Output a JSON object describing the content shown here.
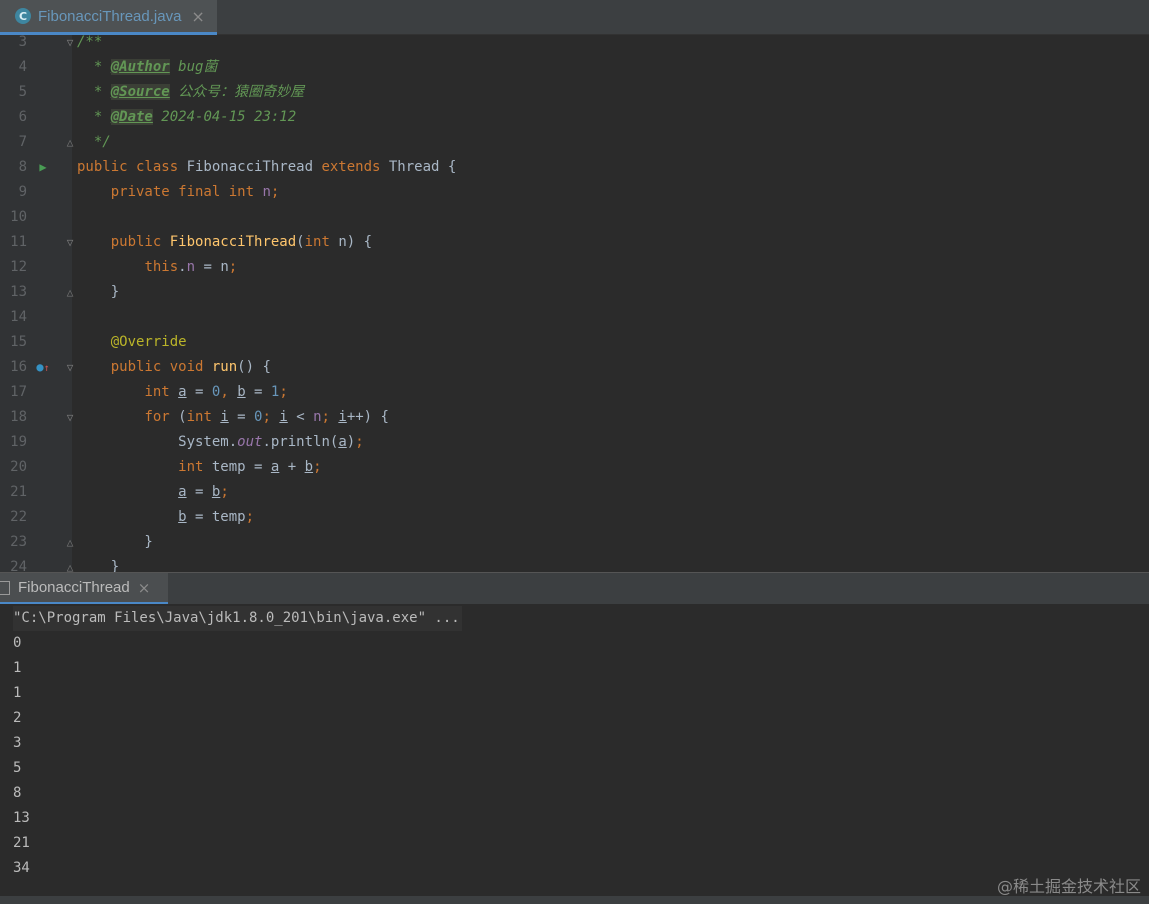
{
  "editor_tab": {
    "icon": "C",
    "label": "FibonacciThread.java",
    "close": "×"
  },
  "code_lines": [
    {
      "n": "3",
      "fold": "▽",
      "html": "<span class=\"cm\">/**</span>"
    },
    {
      "n": "4",
      "html": "<span class=\"cm\">  * </span><span class=\"tag\">@Author</span><span class=\"cm\"> bug菌</span>"
    },
    {
      "n": "5",
      "html": "<span class=\"cm\">  * </span><span class=\"tag\">@Source</span><span class=\"cm\"> 公众号：猿圈奇妙屋</span>"
    },
    {
      "n": "6",
      "html": "<span class=\"cm\">  * </span><span class=\"tag\">@Date</span><span class=\"cm\"> 2024-04-15 23:12</span>"
    },
    {
      "n": "7",
      "fold": "△",
      "html": "<span class=\"cm\">  */</span>"
    },
    {
      "n": "8",
      "icon": "run",
      "html": "<span class=\"kw\">public class </span>FibonacciThread <span class=\"kw\">extends </span>Thread {"
    },
    {
      "n": "9",
      "html": "    <span class=\"kw\">private final int </span><span class=\"fld\">n</span><span class=\"kw\">;</span>"
    },
    {
      "n": "10",
      "html": ""
    },
    {
      "n": "11",
      "fold": "▽",
      "html": "    <span class=\"kw\">public </span><span class=\"fn\">FibonacciThread</span>(<span class=\"kw\">int </span>n) {"
    },
    {
      "n": "12",
      "html": "        <span class=\"kw\">this</span>.<span class=\"fld\">n</span> = n<span class=\"kw\">;</span>"
    },
    {
      "n": "13",
      "fold": "△",
      "html": "    }"
    },
    {
      "n": "14",
      "html": ""
    },
    {
      "n": "15",
      "html": "    <span class=\"ann\">@Override</span>"
    },
    {
      "n": "16",
      "icon": "override",
      "fold": "▽",
      "html": "    <span class=\"kw\">public void </span><span class=\"fn\">run</span>() {"
    },
    {
      "n": "17",
      "html": "        <span class=\"kw\">int </span><span class=\"ul\">a</span> = <span class=\"num\">0</span><span class=\"kw\">, </span><span class=\"ul\">b</span> = <span class=\"num\">1</span><span class=\"kw\">;</span>"
    },
    {
      "n": "18",
      "fold": "▽",
      "html": "        <span class=\"kw\">for </span>(<span class=\"kw\">int </span><span class=\"ul\">i</span> = <span class=\"num\">0</span><span class=\"kw\">; </span><span class=\"ul\">i</span> &lt; <span class=\"fld\">n</span><span class=\"kw\">; </span><span class=\"ul\">i</span>++) {"
    },
    {
      "n": "19",
      "html": "            System.<span class=\"fld-i\">out</span>.println(<span class=\"ul\">a</span>)<span class=\"kw\">;</span>"
    },
    {
      "n": "20",
      "html": "            <span class=\"kw\">int </span>temp = <span class=\"ul\">a</span> + <span class=\"ul\">b</span><span class=\"kw\">;</span>"
    },
    {
      "n": "21",
      "html": "            <span class=\"ul\">a</span> = <span class=\"ul\">b</span><span class=\"kw\">;</span>"
    },
    {
      "n": "22",
      "html": "            <span class=\"ul\">b</span> = temp<span class=\"kw\">;</span>"
    },
    {
      "n": "23",
      "fold": "△",
      "html": "        }"
    },
    {
      "n": "24",
      "fold": "△",
      "html": "    }"
    }
  ],
  "run_tab": {
    "label": "FibonacciThread",
    "close": "×"
  },
  "console": {
    "command": "\"C:\\Program Files\\Java\\jdk1.8.0_201\\bin\\java.exe\" ...",
    "output": [
      "0",
      "1",
      "1",
      "2",
      "3",
      "5",
      "8",
      "13",
      "21",
      "34"
    ]
  },
  "watermark": "@稀土掘金技术社区"
}
